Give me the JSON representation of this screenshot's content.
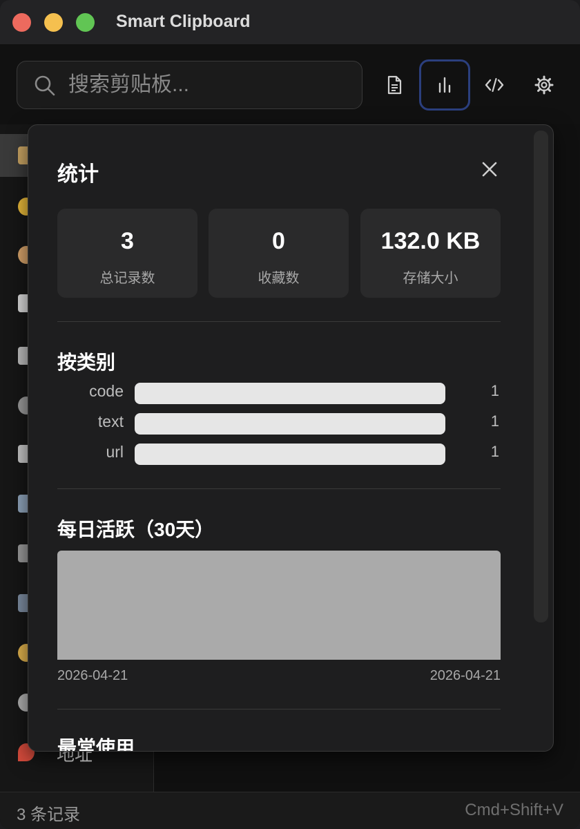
{
  "window": {
    "title": "Smart Clipboard"
  },
  "search": {
    "placeholder": "搜索剪贴板..."
  },
  "toolbar": {
    "buttons": [
      {
        "icon": "document-icon"
      },
      {
        "icon": "bar-chart-icon",
        "active": true
      },
      {
        "icon": "code-icon"
      },
      {
        "icon": "gear-icon"
      }
    ]
  },
  "sidebar": {
    "items": [
      {
        "icon": "clipboard-icon",
        "label": "",
        "active": true
      },
      {
        "icon": "star-icon",
        "label": ""
      },
      {
        "icon": "palette-icon",
        "label": ""
      },
      {
        "icon": "document-icon",
        "label": ""
      },
      {
        "icon": "calendar-icon",
        "label": ""
      },
      {
        "icon": "link-icon",
        "label": ""
      },
      {
        "icon": "image-icon",
        "label": ""
      },
      {
        "icon": "laptop-icon",
        "label": ""
      },
      {
        "icon": "tag-icon",
        "label": ""
      },
      {
        "icon": "folder-icon",
        "label": ""
      },
      {
        "icon": "emoji-icon",
        "label": ""
      },
      {
        "icon": "phone-icon",
        "label": ""
      },
      {
        "icon": "pin-icon",
        "label": "地址"
      }
    ]
  },
  "stats": {
    "title": "统计",
    "cards": [
      {
        "value": "3",
        "label": "总记录数"
      },
      {
        "value": "0",
        "label": "收藏数"
      },
      {
        "value": "132.0 KB",
        "label": "存储大小"
      }
    ],
    "by_category": {
      "title": "按类别",
      "rows": [
        {
          "label": "code",
          "count": "1",
          "fraction": 1.0
        },
        {
          "label": "text",
          "count": "1",
          "fraction": 1.0
        },
        {
          "label": "url",
          "count": "1",
          "fraction": 1.0
        }
      ]
    },
    "daily": {
      "title": "每日活跃（30天）",
      "start_date": "2026-04-21",
      "end_date": "2026-04-21"
    },
    "most_used": {
      "title": "最常使用"
    }
  },
  "status": {
    "count_text": "3 条记录",
    "shortcut": "Cmd+Shift+V"
  },
  "colors": {
    "accent_ring": "#2b3f7e",
    "bar_fill": "#e6e6e6",
    "traffic_close": "#ed6a5e",
    "traffic_min": "#f5c04f",
    "traffic_max": "#61c554"
  }
}
